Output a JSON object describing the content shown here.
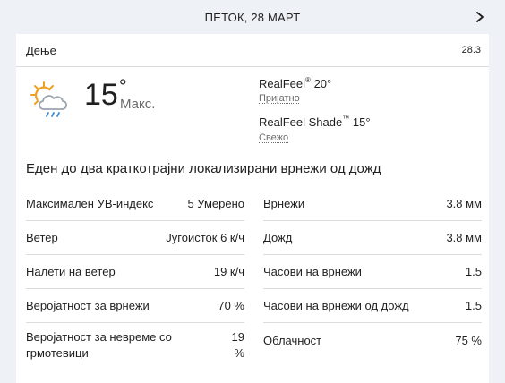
{
  "header": {
    "title": "ПЕТОК, 28 МАРТ"
  },
  "day": {
    "label": "Дење",
    "date": "28.3"
  },
  "current": {
    "icon": "partly-sunny-showers-icon",
    "temp": "15",
    "deg": "°",
    "temp_label": "Макс."
  },
  "realfeel": {
    "label": "RealFeel",
    "value": "20°",
    "desc": "Пријатно",
    "shade_label": "RealFeel Shade",
    "shade_value": "15°",
    "shade_desc": "Свежо"
  },
  "phrase": "Еден до два краткотрајни локализирани врнежи од дожд",
  "stats_left": [
    {
      "label": "Максимален УВ-индекс",
      "value": "5 Умерено"
    },
    {
      "label": "Ветер",
      "value": "Југоисток 6 к/ч"
    },
    {
      "label": "Налети на ветер",
      "value": "19 к/ч"
    },
    {
      "label": "Веројатност за врнежи",
      "value": "70 %"
    },
    {
      "label_line1": "Веројатност за невреме со",
      "label_line2": "грмотевици",
      "value_line1": "19",
      "value_line2": "%"
    }
  ],
  "stats_right": [
    {
      "label": "Врнежи",
      "value": "3.8 мм"
    },
    {
      "label": "Дожд",
      "value": "3.8 мм"
    },
    {
      "label": "Часови на врнежи",
      "value": "1.5"
    },
    {
      "label": "Часови на врнежи од дожд",
      "value": "1.5"
    },
    {
      "label": "Облачност",
      "value": "75 %"
    }
  ],
  "colors": {
    "background": "#eef1f5",
    "card": "#ffffff",
    "divider": "#dcdcdc",
    "icon_sun": "#f0a020",
    "icon_rain": "#3b8ed6"
  }
}
